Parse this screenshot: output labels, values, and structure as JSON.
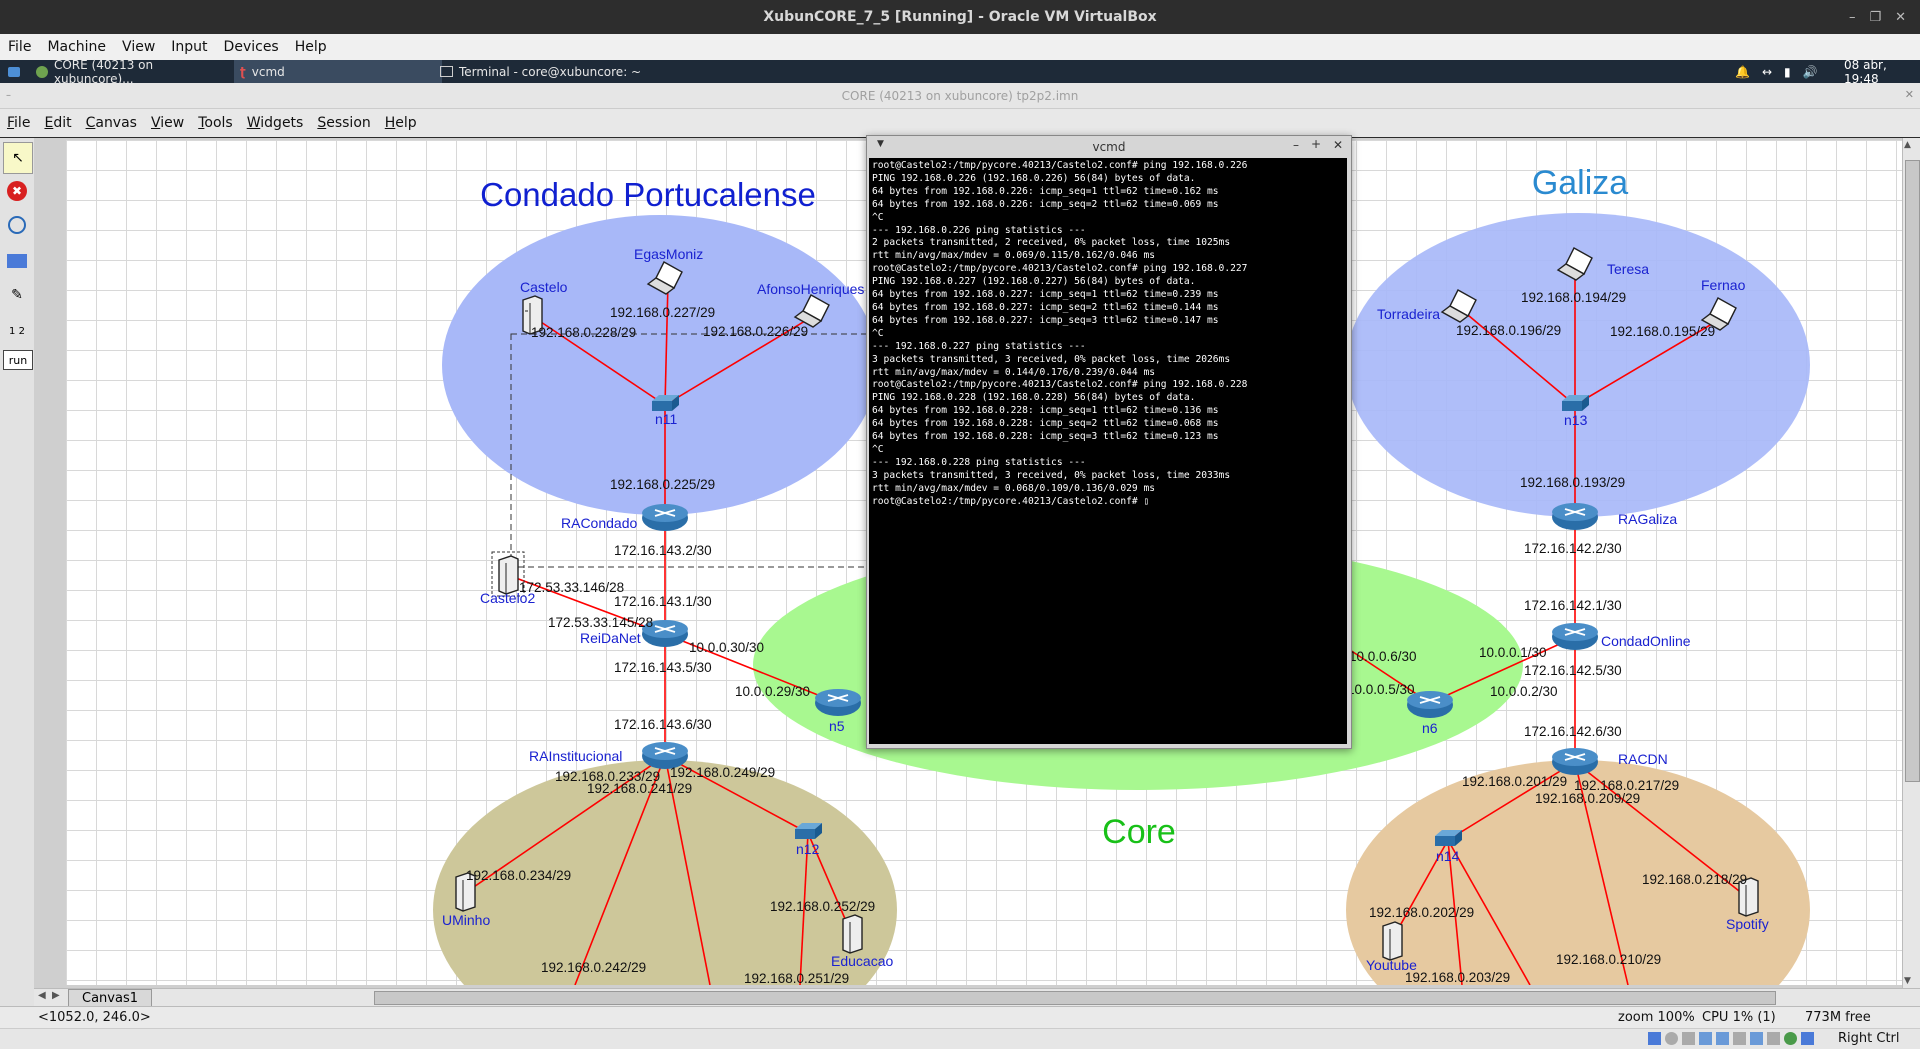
{
  "vbox": {
    "title": "XubunCORE_7_5 [Running] - Oracle VM VirtualBox",
    "menu": [
      "File",
      "Machine",
      "View",
      "Input",
      "Devices",
      "Help"
    ]
  },
  "taskbar": {
    "tasks": [
      {
        "label": "CORE (40213 on xubuncore)...",
        "icon": "core-app-icon"
      },
      {
        "label": "vcmd",
        "icon": "tk-feather-icon"
      },
      {
        "label": "Terminal - core@xubuncore: ~",
        "icon": "terminal-icon"
      }
    ],
    "clock": "08 abr, 19:48"
  },
  "core": {
    "title": "CORE (40213 on xubuncore) tp2p2.imn",
    "menu": [
      "File",
      "Edit",
      "Canvas",
      "View",
      "Tools",
      "Widgets",
      "Session",
      "Help"
    ],
    "tools": [
      {
        "name": "select-tool",
        "glyph": "↖"
      },
      {
        "name": "stop-tool",
        "glyph": "✖"
      },
      {
        "name": "observer-tool",
        "glyph": "🔍"
      },
      {
        "name": "plot-tool",
        "glyph": "〰"
      },
      {
        "name": "marker-tool",
        "glyph": "✎"
      },
      {
        "name": "two-node-tool",
        "glyph": "12"
      },
      {
        "name": "run-tool",
        "glyph": "run"
      }
    ],
    "canvas_tab": "Canvas1",
    "coords": "<1052.0, 246.0>",
    "zoom": "zoom 100%",
    "cpu": "CPU 1% (1)",
    "mem": "773M free",
    "hostkey": "Right Ctrl"
  },
  "areas": {
    "condado": "Condado Portucalense",
    "galiza": "Galiza",
    "core": "Core"
  },
  "nodes": {
    "castelo": "Castelo",
    "egasmoniz": "EgasMoniz",
    "afonso": "AfonsoHenriques",
    "n11": "n11",
    "racondado": "RACondado",
    "castelo2": "Castelo2",
    "reidanet": "ReiDaNet",
    "n5": "n5",
    "rainst": "RAInstitucional",
    "uminho": "UMinho",
    "n12": "n12",
    "educacao": "Educacao",
    "torradeira": "Torradeira",
    "teresa": "Teresa",
    "fernao": "Fernao",
    "n13": "n13",
    "ragaliza": "RAGaliza",
    "condadonline": "CondadOnline",
    "n6": "n6",
    "racdn": "RACDN",
    "n14": "n14",
    "youtube": "Youtube",
    "spotify": "Spotify"
  },
  "links": {
    "l1": "192.168.0.228/29",
    "l2": "192.168.0.227/29",
    "l3": "192.168.0.226/29",
    "l4": "192.168.0.225/29",
    "l5": "172.16.143.2/30",
    "l6": "172.53.33.146/28",
    "l7": "172.16.143.1/30",
    "l8": "172.53.33.145/28",
    "l9": "10.0.0.30/30",
    "l10": "172.16.143.5/30",
    "l11": "10.0.0.29/30",
    "l12": "172.16.143.6/30",
    "l13": "192.168.0.233/29",
    "l14": "192.168.0.249/29",
    "l15": "192.168.0.241/29",
    "l16": "192.168.0.234/29",
    "l17": "192.168.0.252/29",
    "l18": "192.168.0.242/29",
    "l19": "192.168.0.251/29",
    "g1": "192.168.0.194/29",
    "g2": "192.168.0.196/29",
    "g3": "192.168.0.195/29",
    "g4": "192.168.0.193/29",
    "g5": "172.16.142.2/30",
    "g6": "172.16.142.1/30",
    "g7": "10.0.0.1/30",
    "g8": "172.16.142.5/30",
    "g9": "10.0.0.6/30",
    "g10": "10.0.0.5/30",
    "g11": "10.0.0.2/30",
    "g12": "172.16.142.6/30",
    "g13": "192.168.0.201/29",
    "g14": "192.168.0.217/29",
    "g15": "192.168.0.209/29",
    "g16": "192.168.0.218/29",
    "g17": "192.168.0.202/29",
    "g18": "192.168.0.210/29",
    "g19": "192.168.0.203/29"
  },
  "vcmd": {
    "title": "vcmd",
    "lines": [
      "root@Castelo2:/tmp/pycore.40213/Castelo2.conf# ping 192.168.0.226",
      "PING 192.168.0.226 (192.168.0.226) 56(84) bytes of data.",
      "64 bytes from 192.168.0.226: icmp_seq=1 ttl=62 time=0.162 ms",
      "64 bytes from 192.168.0.226: icmp_seq=2 ttl=62 time=0.069 ms",
      "^C",
      "--- 192.168.0.226 ping statistics ---",
      "2 packets transmitted, 2 received, 0% packet loss, time 1025ms",
      "rtt min/avg/max/mdev = 0.069/0.115/0.162/0.046 ms",
      "root@Castelo2:/tmp/pycore.40213/Castelo2.conf# ping 192.168.0.227",
      "PING 192.168.0.227 (192.168.0.227) 56(84) bytes of data.",
      "64 bytes from 192.168.0.227: icmp_seq=1 ttl=62 time=0.239 ms",
      "64 bytes from 192.168.0.227: icmp_seq=2 ttl=62 time=0.144 ms",
      "64 bytes from 192.168.0.227: icmp_seq=3 ttl=62 time=0.147 ms",
      "^C",
      "--- 192.168.0.227 ping statistics ---",
      "3 packets transmitted, 3 received, 0% packet loss, time 2026ms",
      "rtt min/avg/max/mdev = 0.144/0.176/0.239/0.044 ms",
      "root@Castelo2:/tmp/pycore.40213/Castelo2.conf# ping 192.168.0.228",
      "PING 192.168.0.228 (192.168.0.228) 56(84) bytes of data.",
      "64 bytes from 192.168.0.228: icmp_seq=1 ttl=62 time=0.136 ms",
      "64 bytes from 192.168.0.228: icmp_seq=2 ttl=62 time=0.068 ms",
      "64 bytes from 192.168.0.228: icmp_seq=3 ttl=62 time=0.123 ms",
      "^C",
      "--- 192.168.0.228 ping statistics ---",
      "3 packets transmitted, 3 received, 0% packet loss, time 2033ms",
      "rtt min/avg/max/mdev = 0.068/0.109/0.136/0.029 ms",
      "root@Castelo2:/tmp/pycore.40213/Castelo2.conf# ▯"
    ]
  },
  "colors": {
    "link": "#ff0000",
    "area_blue": "#a8b8f8",
    "area_green": "#a8f890",
    "area_olive": "#cdc79a",
    "area_tan": "#e6c9a0",
    "title_blue": "#1020d0",
    "title_teal": "#2a8ad0",
    "title_green": "#18c018",
    "node_label": "#1a22d0"
  }
}
